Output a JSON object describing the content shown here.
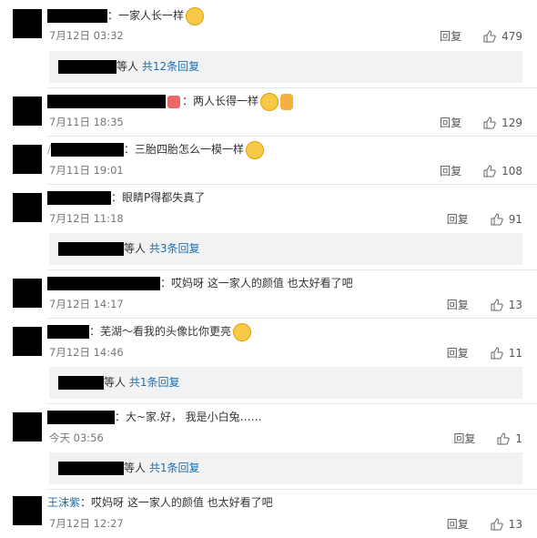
{
  "comments": [
    {
      "text": "：一家人长一样",
      "time": "7月12日 03:32",
      "reply": "回复",
      "likes": "479",
      "emoji": "grin-emoji"
    },
    {
      "text": "：两人长得一样",
      "time": "7月11日 18:35",
      "reply": "回复",
      "likes": "129",
      "emoji": "laugh-emoji"
    },
    {
      "prefix": "/",
      "text": "：三胎四胎怎么一模一样",
      "time": "7月11日 19:01",
      "reply": "回复",
      "likes": "108",
      "emoji": "tears-emoji"
    },
    {
      "text": "：眼睛P得都失真了",
      "time": "7月12日 11:18",
      "reply": "回复",
      "likes": "91"
    },
    {
      "text": "：哎妈呀 这一家人的颜值 也太好看了吧",
      "time": "7月12日 14:17",
      "reply": "回复",
      "likes": "13"
    },
    {
      "text": "：芜湖～看我的头像比你更亮",
      "time": "7月12日 14:46",
      "reply": "回复",
      "likes": "11",
      "emoji": "kiss-emoji"
    },
    {
      "text": "：大~家.好， 我是小白兔……",
      "time": "今天 03:56",
      "reply": "回复",
      "likes": "1"
    },
    {
      "name": "王沫紫",
      "text": "：哎妈呀 这一家人的颜值 也太好看了吧",
      "time": "7月12日 12:27",
      "reply": "回复",
      "likes": "13"
    }
  ],
  "subreplies": [
    {
      "etc": "等人",
      "count": "共12条回复"
    },
    {
      "etc": "等人",
      "count": "共3条回复"
    },
    {
      "etc": "等人",
      "count": "共1条回复"
    },
    {
      "etc": "等人",
      "count": "共1条回复"
    }
  ]
}
